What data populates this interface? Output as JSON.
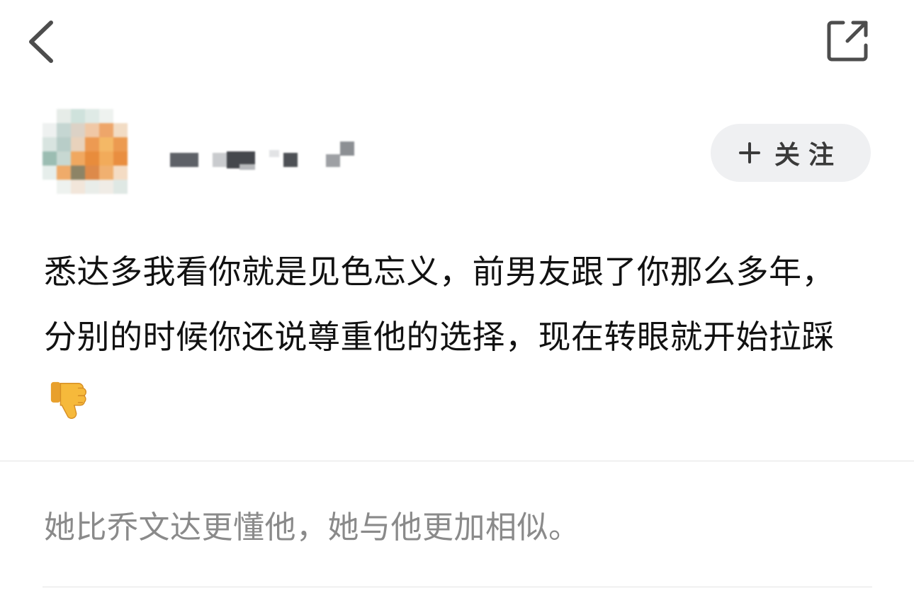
{
  "nav": {
    "back_icon": "chevron-left-icon",
    "share_icon": "external-link-icon"
  },
  "author": {
    "avatar": "pixelated-avatar",
    "name_obscured": true,
    "follow_label": "关注",
    "follow_icon": "plus-icon"
  },
  "post": {
    "text": "悉达多我看你就是见色忘义，前男友跟了你那么多年，分别的时候你还说尊重他的选择，现在转眼就开始拉踩",
    "emoji": "thumbs-down-icon"
  },
  "reply": {
    "text": "她比乔文达更懂他，她与他更加相似。"
  },
  "colors": {
    "background": "#ffffff",
    "text_primary": "#111111",
    "text_secondary": "#8a8a8a",
    "follow_bg": "#eff0f2",
    "divider": "#e3e3e3",
    "emoji": "#f6b93b"
  }
}
